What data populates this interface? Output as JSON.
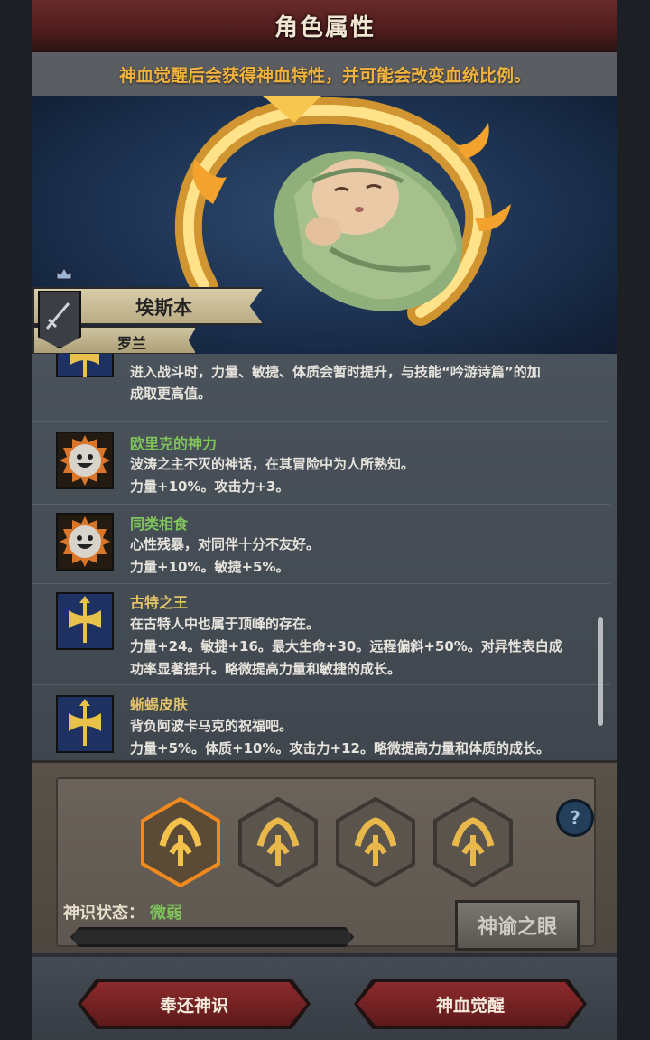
{
  "title": "角色属性",
  "notice": "神血觉醒后会获得神血特性，并可能会改变血统比例。",
  "character": {
    "name": "埃斯本",
    "origin": "罗兰"
  },
  "traits": [
    {
      "name": "",
      "icon": "golden-axe-icon",
      "description": "进入战斗时，力量、敏捷、体质会暂时提升，与技能“吟游诗篇”的加",
      "effect": "成取更高值。"
    },
    {
      "name": "欧里克的神力",
      "icon": "smiley-face-icon",
      "description": "波涛之主不灭的神话，在其冒险中为人所熟知。",
      "effect": "力量+10%。攻击力+3。"
    },
    {
      "name": "同类相食",
      "icon": "smiley-face-icon",
      "description": "心性残暴，对同伴十分不友好。",
      "effect": "力量+10%。敏捷+5%。"
    },
    {
      "name": "古特之王",
      "icon": "golden-axe-icon",
      "description": "在古特人中也属于顶峰的存在。",
      "effect": "力量+24。敏捷+16。最大生命+30。远程偏斜+50%。对异性表白成",
      "effect2": "功率显著提升。略微提高力量和敏捷的成长。"
    },
    {
      "name": "蜥蜴皮肤",
      "icon": "golden-axe-icon",
      "description": "背负阿波卡马克的祝福吧。",
      "effect": "力量+5%。体质+10%。攻击力+12。略微提高力量和体质的成长。"
    }
  ],
  "divine": {
    "status_label": "神识状态：",
    "status_value": "微弱",
    "progress": 0.0,
    "oracle_button": "神谕之眼",
    "help": "?"
  },
  "footer": {
    "return_button": "奉还神识",
    "awaken_button": "神血觉醒"
  },
  "colors": {
    "accent_orange": "#f1b23e",
    "trait_green": "#7fc45a",
    "trait_gold": "#e3c36a",
    "button_red": "#8c2a2c"
  }
}
